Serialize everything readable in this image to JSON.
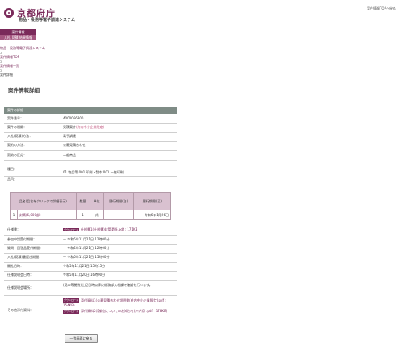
{
  "header": {
    "logo_text": "京都府庁",
    "system_name": "物品・役務等電子調達システム",
    "top_link": "案件情報TOPへ戻る"
  },
  "menu": [
    {
      "label": "案件情報"
    },
    {
      "label": "入札(見積)結果情報"
    }
  ],
  "breadcrumb": [
    "物品・役務等電子調達システム",
    ">",
    "案件情報TOP",
    ">",
    "案件情報一覧",
    ">",
    "案件詳細"
  ],
  "page_title": "案件情報詳細",
  "section_title": "案件の詳細",
  "fields": {
    "case_no_label": "案件番号：",
    "case_no": "4000066800",
    "kind_label": "案件の種類：",
    "kind": "見積案件",
    "kind_note": "(府内中小企業限定)",
    "method_label": "入札(見積)方法：",
    "method": "電子調達",
    "contract_method_label": "契約の方法：",
    "contract_method": "公募見積合わせ",
    "category_label": "契約の区分：",
    "category": "一般商品",
    "item_type_label": "種目：",
    "item_type": "01 物品等 001 印刷・製本 001 一般印刷",
    "goods_label": "品目："
  },
  "items_table": {
    "headers": [
      "品名(品名をクリックで詳細表示)",
      "数量",
      "単位",
      "履行期間(自)",
      "履行期間(至)"
    ],
    "rows": [
      [
        "1",
        "封筒(6,000部)",
        "1",
        "式",
        "",
        "令和6年1月26日"
      ]
    ]
  },
  "details": {
    "spec_label": "仕様書：",
    "spec_badge": "ダウンロード",
    "spec_file": "仕様書1(仕様書)封筒関係.pdf : 171KB",
    "entry_period_label": "参加申請受付期間：",
    "entry_period": "令和5年11月21日 12時00分",
    "question_period_label": "質問・回答品受付期間：",
    "question_period": "令和5年11月21日 12時00分",
    "bid_period_label": "入札(見積)書提出期間：",
    "bid_period": "令和5年11月21日 15時00分",
    "open_date_label": "開札日時：",
    "open_date": "令和5年11月21日 15時15分",
    "review_date_label": "仕様説明会日時：",
    "review_date": "令和5年11月20日 16時00分",
    "review_place_label": "仕様説明会場所：",
    "review_place": "(見本等閲覧)上記日時以降に総務部入札課で確認を行います。",
    "other_label": "その他添付資料：",
    "other_badge": "ダウンロード",
    "other_file1": "添付資料1(公募見積合わせ説明書(府内中小企業限定).pdf : 154KB)",
    "other_file2": "添付資料2(【様位についてのお知らせ(庁内)】.pdf : 178KB)"
  },
  "back_button": "一覧画面に戻る"
}
